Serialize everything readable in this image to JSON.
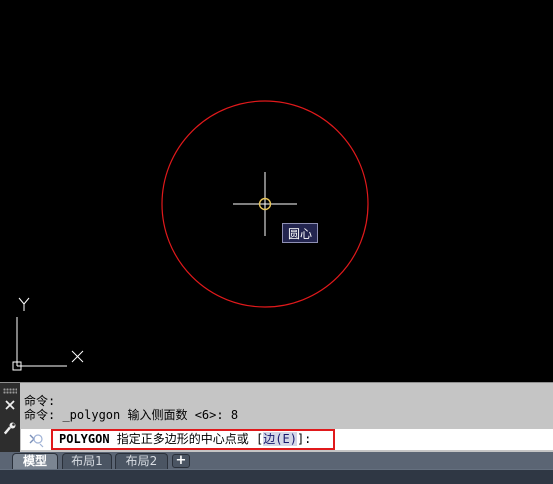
{
  "canvas": {
    "background": "#000000",
    "circle_color": "#e0191b",
    "crosshair_color": "#ffffff",
    "ucs_color": "#ffffff",
    "ucs_y_label": "Y",
    "ucs_x_label": "X",
    "osnap_tooltip": "圆心",
    "crosshair_icon": "crosshair-cursor-icon",
    "center_marker_icon": "center-osnap-marker-icon"
  },
  "command_line": {
    "history": [
      "命令:",
      "命令: _polygon 输入侧面数 <6>: 8"
    ],
    "prompt": {
      "command": "POLYGON",
      "text": " 指定正多边形的中心点或 [",
      "option_label": "边(E)",
      "suffix": "]:"
    },
    "close_icon": "close-icon",
    "customize_icon": "wrench-icon",
    "prompt_icon": "command-prompt-icon",
    "highlight_color": "#e0191b"
  },
  "tabs": {
    "items": [
      {
        "label": "模型",
        "active": true
      },
      {
        "label": "布局1",
        "active": false
      },
      {
        "label": "布局2",
        "active": false
      }
    ],
    "add_label": "+"
  }
}
